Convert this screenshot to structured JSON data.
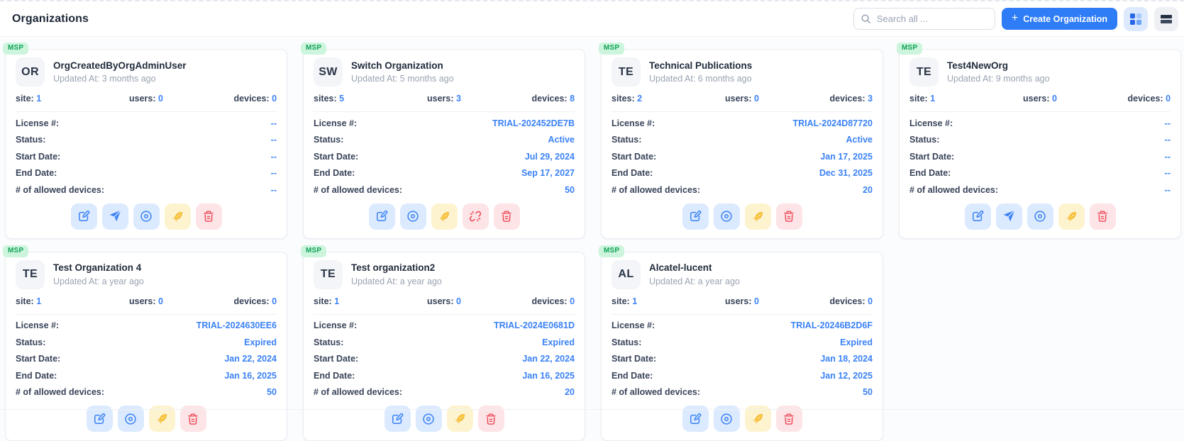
{
  "header": {
    "title": "Organizations",
    "search_placeholder": "Search all ...",
    "create_plus": "+",
    "create_button": "Create Organization"
  },
  "colors": {
    "accent_blue": "#3b82f6",
    "create_button_bg": "#2e7cf6",
    "badge_green_bg": "#cdf5dd",
    "badge_green_text": "#12a257",
    "action_blue_bg": "#dbeafe",
    "action_yellow_bg": "#fdf3cf",
    "action_red_bg": "#fde4e6"
  },
  "cards": [
    {
      "badge": "MSP",
      "initials": "OR",
      "name": "OrgCreatedByOrgAdminUser",
      "updated": "Updated At: 3 months ago",
      "stats": [
        {
          "label": "site:",
          "value": "1"
        },
        {
          "label": "users:",
          "value": "0"
        },
        {
          "label": "devices:",
          "value": "0"
        }
      ],
      "details": [
        {
          "label": "License #:",
          "value": "--"
        },
        {
          "label": "Status:",
          "value": "--"
        },
        {
          "label": "Start Date:",
          "value": "--"
        },
        {
          "label": "End Date:",
          "value": "--"
        },
        {
          "label": "# of allowed devices:",
          "value": "--"
        }
      ],
      "actions": [
        "edit",
        "send",
        "view",
        "launch",
        "delete"
      ]
    },
    {
      "badge": "MSP",
      "initials": "SW",
      "name": "Switch Organization",
      "updated": "Updated At: 5 months ago",
      "stats": [
        {
          "label": "sites:",
          "value": "5"
        },
        {
          "label": "users:",
          "value": "3"
        },
        {
          "label": "devices:",
          "value": "8"
        }
      ],
      "details": [
        {
          "label": "License #:",
          "value": "TRIAL-202452DE7B"
        },
        {
          "label": "Status:",
          "value": "Active"
        },
        {
          "label": "Start Date:",
          "value": "Jul 29, 2024"
        },
        {
          "label": "End Date:",
          "value": "Sep 17, 2027"
        },
        {
          "label": "# of allowed devices:",
          "value": "50"
        }
      ],
      "actions": [
        "edit",
        "view",
        "launch",
        "unlink",
        "delete"
      ]
    },
    {
      "badge": "MSP",
      "initials": "TE",
      "name": "Technical Publications",
      "updated": "Updated At: 6 months ago",
      "stats": [
        {
          "label": "sites:",
          "value": "2"
        },
        {
          "label": "users:",
          "value": "0"
        },
        {
          "label": "devices:",
          "value": "3"
        }
      ],
      "details": [
        {
          "label": "License #:",
          "value": "TRIAL-2024D87720"
        },
        {
          "label": "Status:",
          "value": "Active"
        },
        {
          "label": "Start Date:",
          "value": "Jan 17, 2025"
        },
        {
          "label": "End Date:",
          "value": "Dec 31, 2025"
        },
        {
          "label": "# of allowed devices:",
          "value": "20"
        }
      ],
      "actions": [
        "edit",
        "view",
        "launch",
        "delete"
      ]
    },
    {
      "badge": "MSP",
      "initials": "TE",
      "name": "Test4NewOrg",
      "updated": "Updated At: 9 months ago",
      "stats": [
        {
          "label": "site:",
          "value": "1"
        },
        {
          "label": "users:",
          "value": "0"
        },
        {
          "label": "devices:",
          "value": "0"
        }
      ],
      "details": [
        {
          "label": "License #:",
          "value": "--"
        },
        {
          "label": "Status:",
          "value": "--"
        },
        {
          "label": "Start Date:",
          "value": "--"
        },
        {
          "label": "End Date:",
          "value": "--"
        },
        {
          "label": "# of allowed devices:",
          "value": "--"
        }
      ],
      "actions": [
        "edit",
        "send",
        "view",
        "launch",
        "delete"
      ]
    },
    {
      "badge": "MSP",
      "initials": "TE",
      "name": "Test Organization 4",
      "updated": "Updated At: a year ago",
      "stats": [
        {
          "label": "site:",
          "value": "1"
        },
        {
          "label": "users:",
          "value": "0"
        },
        {
          "label": "devices:",
          "value": "0"
        }
      ],
      "details": [
        {
          "label": "License #:",
          "value": "TRIAL-2024630EE6"
        },
        {
          "label": "Status:",
          "value": "Expired"
        },
        {
          "label": "Start Date:",
          "value": "Jan 22, 2024"
        },
        {
          "label": "End Date:",
          "value": "Jan 16, 2025"
        },
        {
          "label": "# of allowed devices:",
          "value": "50"
        }
      ],
      "actions": [
        "edit",
        "view",
        "launch",
        "delete"
      ]
    },
    {
      "badge": "MSP",
      "initials": "TE",
      "name": "Test organization2",
      "updated": "Updated At: a year ago",
      "stats": [
        {
          "label": "site:",
          "value": "1"
        },
        {
          "label": "users:",
          "value": "0"
        },
        {
          "label": "devices:",
          "value": "0"
        }
      ],
      "details": [
        {
          "label": "License #:",
          "value": "TRIAL-2024E0681D"
        },
        {
          "label": "Status:",
          "value": "Expired"
        },
        {
          "label": "Start Date:",
          "value": "Jan 22, 2024"
        },
        {
          "label": "End Date:",
          "value": "Jan 16, 2025"
        },
        {
          "label": "# of allowed devices:",
          "value": "20"
        }
      ],
      "actions": [
        "edit",
        "view",
        "launch",
        "delete"
      ]
    },
    {
      "badge": "MSP",
      "initials": "AL",
      "name": "Alcatel-lucent",
      "updated": "Updated At: a year ago",
      "stats": [
        {
          "label": "site:",
          "value": "1"
        },
        {
          "label": "users:",
          "value": "0"
        },
        {
          "label": "devices:",
          "value": "0"
        }
      ],
      "details": [
        {
          "label": "License #:",
          "value": "TRIAL-20246B2D6F"
        },
        {
          "label": "Status:",
          "value": "Expired"
        },
        {
          "label": "Start Date:",
          "value": "Jan 18, 2024"
        },
        {
          "label": "End Date:",
          "value": "Jan 12, 2025"
        },
        {
          "label": "# of allowed devices:",
          "value": "50"
        }
      ],
      "actions": [
        "edit",
        "view",
        "launch",
        "delete"
      ]
    }
  ]
}
